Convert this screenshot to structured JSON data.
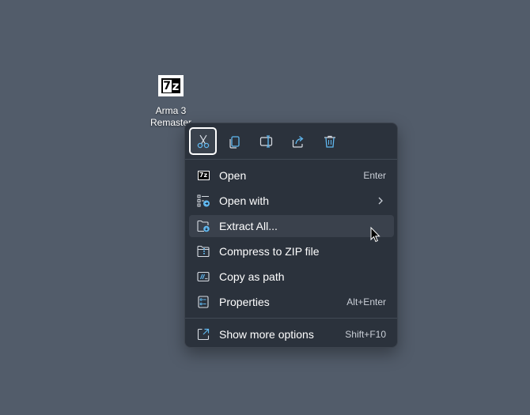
{
  "desktop_icon": {
    "icon": "7z-archive-icon",
    "label_line1": "Arma 3",
    "label_line2": "Remaster"
  },
  "context_menu": {
    "toolbar": [
      {
        "name": "cut",
        "icon": "scissors-icon"
      },
      {
        "name": "copy",
        "icon": "copy-icon"
      },
      {
        "name": "rename",
        "icon": "rename-icon"
      },
      {
        "name": "share",
        "icon": "share-icon"
      },
      {
        "name": "delete",
        "icon": "trash-icon"
      }
    ],
    "items": [
      {
        "label": "Open",
        "shortcut": "Enter",
        "icon": "7z-icon"
      },
      {
        "label": "Open with",
        "shortcut": "",
        "icon": "open-with-icon",
        "submenu": true
      },
      {
        "label": "Extract All...",
        "shortcut": "",
        "icon": "extract-folder-icon"
      },
      {
        "label": "Compress to ZIP file",
        "shortcut": "",
        "icon": "zip-folder-icon"
      },
      {
        "label": "Copy as path",
        "shortcut": "",
        "icon": "copy-path-icon"
      },
      {
        "label": "Properties",
        "shortcut": "Alt+Enter",
        "icon": "properties-icon"
      }
    ],
    "more": {
      "label": "Show more options",
      "shortcut": "Shift+F10",
      "icon": "expand-icon"
    }
  },
  "colors": {
    "desktop": "#525c6a",
    "menu_bg": "#2b323c",
    "hover_bg": "#3a414c",
    "accent_icon": "#60b8f0"
  }
}
